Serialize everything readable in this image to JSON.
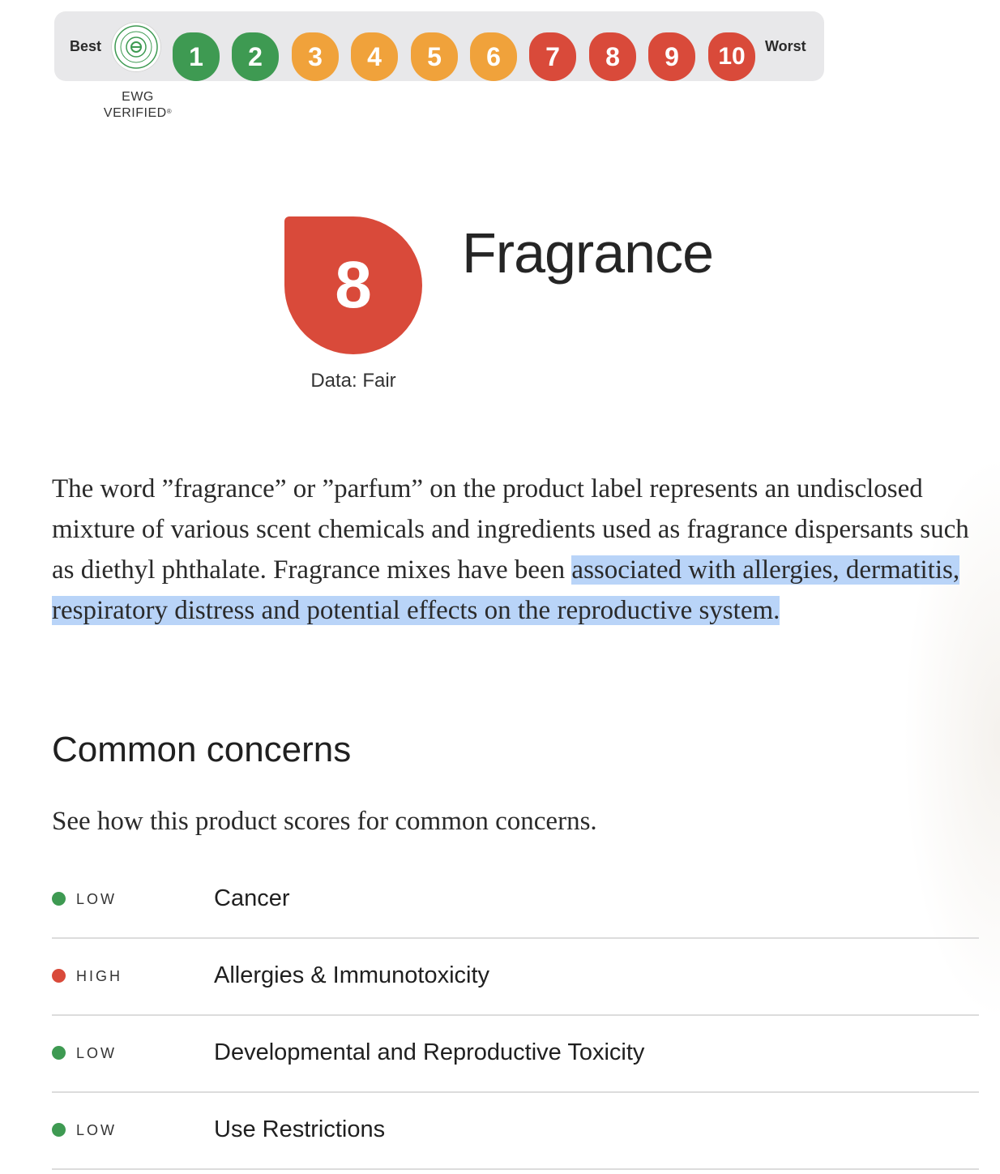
{
  "scale": {
    "best_label": "Best",
    "worst_label": "Worst",
    "verified_caption": "EWG VERIFIED",
    "verified_mark": "®",
    "badge_text": "EWG VERIFIED",
    "scores": [
      {
        "value": "1",
        "color": "#3e9a52",
        "level": "green"
      },
      {
        "value": "2",
        "color": "#3e9a52",
        "level": "green"
      },
      {
        "value": "3",
        "color": "#f0a23b",
        "level": "orange"
      },
      {
        "value": "4",
        "color": "#f0a23b",
        "level": "orange"
      },
      {
        "value": "5",
        "color": "#f0a23b",
        "level": "orange"
      },
      {
        "value": "6",
        "color": "#f0a23b",
        "level": "orange"
      },
      {
        "value": "7",
        "color": "#d94a3a",
        "level": "red"
      },
      {
        "value": "8",
        "color": "#d94a3a",
        "level": "red"
      },
      {
        "value": "9",
        "color": "#d94a3a",
        "level": "red"
      },
      {
        "value": "10",
        "color": "#d94a3a",
        "level": "red"
      }
    ]
  },
  "ingredient": {
    "score": "8",
    "score_color": "#d94a3a",
    "data_availability": "Data: Fair",
    "name": "Fragrance"
  },
  "description": {
    "text_plain": "The word ”fragrance” or ”parfum” on the product label represents an undisclosed mixture of various scent chemicals and ingredients used as fragrance dispersants such as diethyl phthalate. Fragrance mixes have been ",
    "text_highlighted": "associated with allergies, dermatitis, respiratory distress and potential effects on the reproductive system."
  },
  "concerns": {
    "heading": "Common concerns",
    "intro": "See how this product scores for common concerns.",
    "items": [
      {
        "level": "LOW",
        "level_key": "low",
        "name": "Cancer"
      },
      {
        "level": "HIGH",
        "level_key": "high",
        "name": "Allergies & Immunotoxicity"
      },
      {
        "level": "LOW",
        "level_key": "low",
        "name": "Developmental and Reproductive Toxicity"
      },
      {
        "level": "LOW",
        "level_key": "low",
        "name": "Use Restrictions"
      }
    ]
  },
  "colors": {
    "low": "#3e9a52",
    "moderate": "#f0a23b",
    "high": "#d94a3a",
    "selection_highlight": "#b9d4f8"
  },
  "icons": {
    "verified_badge": "ewg-verified-seal-icon",
    "concern_dot": "status-dot-icon"
  }
}
